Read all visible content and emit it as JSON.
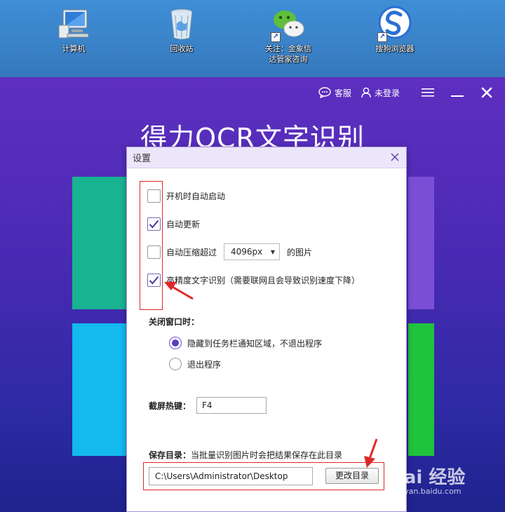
{
  "desktop": {
    "icons": [
      {
        "label": "计算机",
        "icon": "computer-icon"
      },
      {
        "label": "回收站",
        "icon": "recycle-bin-icon"
      },
      {
        "label_line1": "关注：金象信",
        "label_line2": "达管家咨询",
        "icon": "wechat-icon"
      },
      {
        "label": "搜狗浏览器",
        "icon": "sogou-browser-icon"
      }
    ]
  },
  "app": {
    "title": "得力OCR文字识别",
    "topbar": {
      "service_label": "客服",
      "login_label": "未登录"
    }
  },
  "dialog": {
    "title": "设置",
    "options": {
      "autostart": {
        "label": "开机时自动启动",
        "checked": false
      },
      "autoupdate": {
        "label": "自动更新",
        "checked": true
      },
      "compress": {
        "label_before": "自动压缩超过",
        "value": "4096px",
        "label_after": "的图片",
        "checked": false
      },
      "highprecision": {
        "label": "高精度文字识别（需要联网且会导致识别速度下降）",
        "checked": true
      }
    },
    "close_window": {
      "label": "关闭窗口时：",
      "options": [
        {
          "label": "隐藏到任务栏通知区域，不退出程序",
          "selected": true
        },
        {
          "label": "退出程序",
          "selected": false
        }
      ]
    },
    "hotkey": {
      "label": "截屏热键：",
      "value": "F4"
    },
    "save_dir": {
      "label": "保存目录：",
      "hint": "当批量识别图片时会把结果保存在此目录",
      "path": "C:\\Users\\Administrator\\Desktop",
      "button": "更改目录"
    }
  },
  "watermark": {
    "text": "Bai 经验",
    "sub": "jingyan.baidu.com"
  },
  "colors": {
    "accent": "#5b3cc0",
    "annotation": "#e02828",
    "title_bg": "#ece6fa"
  }
}
